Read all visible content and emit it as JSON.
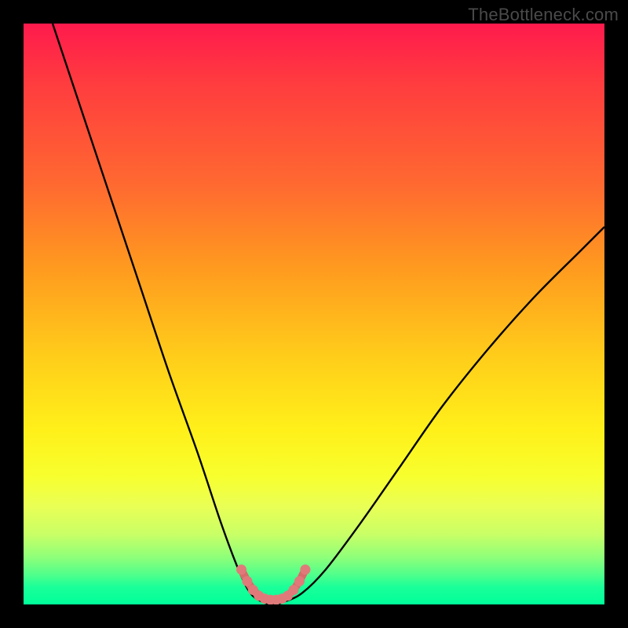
{
  "watermark": "TheBottleneck.com",
  "colors": {
    "frame": "#000000",
    "curve": "#000000",
    "valley_marker": "#e07a7a",
    "valley_marker_stroke": "#d86b6b"
  },
  "chart_data": {
    "type": "line",
    "title": "",
    "xlabel": "",
    "ylabel": "",
    "xlim": [
      0,
      100
    ],
    "ylim": [
      0,
      100
    ],
    "grid": false,
    "legend": false,
    "series": [
      {
        "name": "bottleneck-curve",
        "x": [
          5,
          10,
          15,
          20,
          25,
          30,
          34,
          37,
          39,
          41,
          43,
          45,
          48,
          52,
          58,
          65,
          72,
          80,
          88,
          96,
          100
        ],
        "y": [
          100,
          85,
          70,
          55,
          40,
          26,
          14,
          6,
          2,
          0.5,
          0,
          0.5,
          2,
          6,
          14,
          24,
          34,
          44,
          53,
          61,
          65
        ]
      }
    ],
    "valley_marker": {
      "name": "optimal-range",
      "points": [
        {
          "x": 37.5,
          "y": 6.0
        },
        {
          "x": 38.5,
          "y": 4.0
        },
        {
          "x": 39.5,
          "y": 2.5
        },
        {
          "x": 40.5,
          "y": 1.5
        },
        {
          "x": 41.5,
          "y": 1.0
        },
        {
          "x": 42.5,
          "y": 0.8
        },
        {
          "x": 43.5,
          "y": 0.8
        },
        {
          "x": 44.5,
          "y": 1.0
        },
        {
          "x": 45.5,
          "y": 1.5
        },
        {
          "x": 46.5,
          "y": 2.5
        },
        {
          "x": 47.5,
          "y": 4.0
        },
        {
          "x": 48.5,
          "y": 6.0
        }
      ]
    }
  }
}
